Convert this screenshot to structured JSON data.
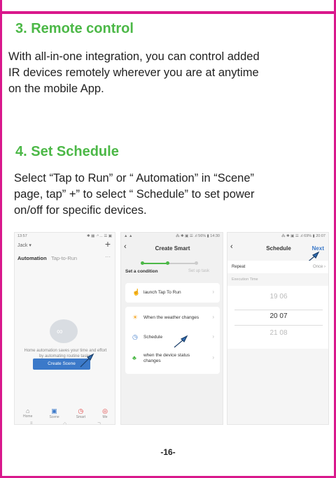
{
  "section3": {
    "title": "3. Remote control",
    "body_lines": [
      "With all-in-one integration, you can control added",
      "IR devices remotely wherever you are at anytime",
      "on the mobile App."
    ]
  },
  "section4": {
    "title": "4. Set Schedule",
    "body_lines": [
      "Select “Tap to Run” or “ Automation” in “Scene”",
      "page, tap” +” to select “ Schedule” to set power",
      "on/off for specific devices."
    ]
  },
  "screen1": {
    "status_left": "13:57",
    "status_right": "✱ ▦ ·ᵊ ... ☰ ▣",
    "home_name": "Jack ▾",
    "plus": "+",
    "tab_active": "Automation",
    "tab_inactive": "Tap-to-Run",
    "more": "···",
    "message_lines": [
      "Home automation saves your time and effort",
      "by automating routine tasks."
    ],
    "button": "Create Scene",
    "nav": [
      {
        "label": "Home",
        "icon": "⌂"
      },
      {
        "label": "Scene",
        "icon": "▣"
      },
      {
        "label": "Smart",
        "icon": "◷"
      },
      {
        "label": "Me",
        "icon": "◎"
      }
    ],
    "sys_keys": [
      "≡",
      "◇",
      "⊐"
    ]
  },
  "screen2": {
    "status_left": "▲ ▲",
    "status_right": "⁂ ✱ ▣ ☰ .ıl 56% ▮ 14:30",
    "back": "‹",
    "title": "Create Smart",
    "step1": "Set a condition",
    "step2": "Set up task",
    "rows": [
      {
        "label": "launch Tap To Run",
        "icon": "☝"
      },
      {
        "label": "When the weather changes",
        "icon": "☀"
      },
      {
        "label": "Schedule",
        "icon": "◷"
      },
      {
        "label": "when the device status\nchanges",
        "icon": "♣"
      }
    ],
    "chevron": "›"
  },
  "screen3": {
    "status_right": "⁂ ✱ ▣ ☰ .ıl 69% ▮ 20:07",
    "back": "‹",
    "title": "Schedule",
    "next": "Next",
    "repeat_label": "Repeat",
    "repeat_value": "Once  ›",
    "execution_label": "Execution Time",
    "picker": [
      "19  06",
      "20  07",
      "21  08"
    ]
  },
  "page_number": "-16-",
  "colors": {
    "accent": "#d9188c",
    "heading": "#4cb847",
    "app_blue": "#3b79c9"
  }
}
